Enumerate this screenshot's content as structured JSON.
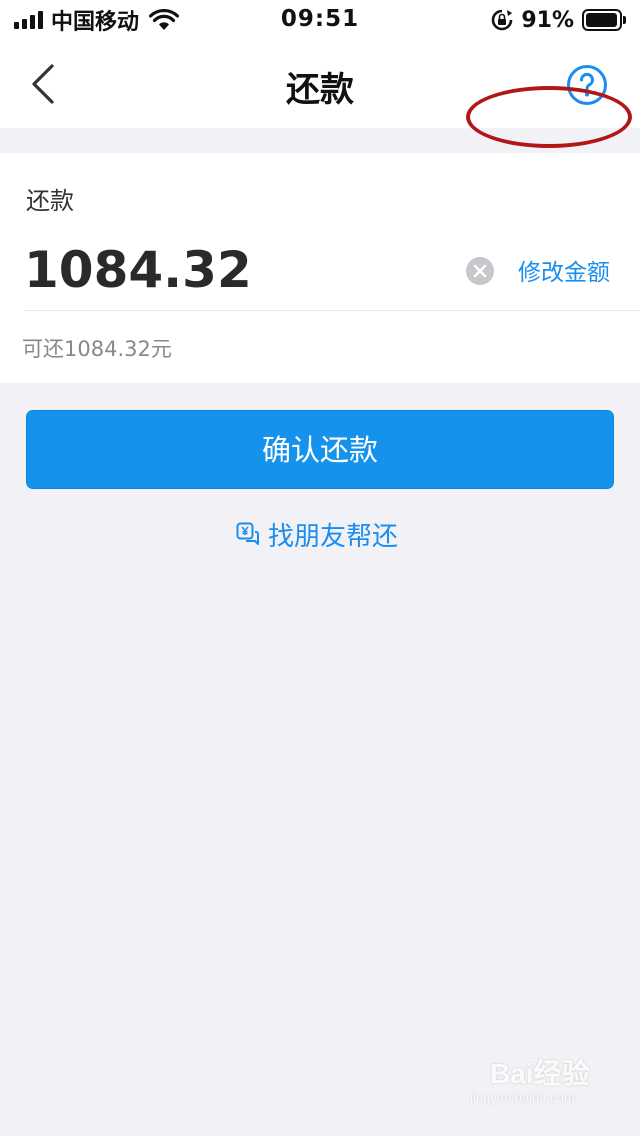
{
  "status_bar": {
    "carrier": "中国移动",
    "time": "09:51",
    "battery_percent": "91%",
    "battery_level": 0.91
  },
  "nav": {
    "title": "还款",
    "back_icon": "chevron-left-icon",
    "help_icon": "question-circle-icon"
  },
  "repay_card": {
    "label": "还款",
    "amount": "1084.32",
    "modify_label": "修改金额",
    "available_text": "可还1084.32元"
  },
  "actions": {
    "confirm_label": "确认还款",
    "friend_help_label": "找朋友帮还"
  },
  "watermark": {
    "brand": "Bai经验",
    "url": "jingyan.baidu.com"
  },
  "colors": {
    "accent": "#1592ec",
    "link": "#1a8ef0",
    "annotation": "#b01818",
    "background": "#f2f2f6"
  }
}
